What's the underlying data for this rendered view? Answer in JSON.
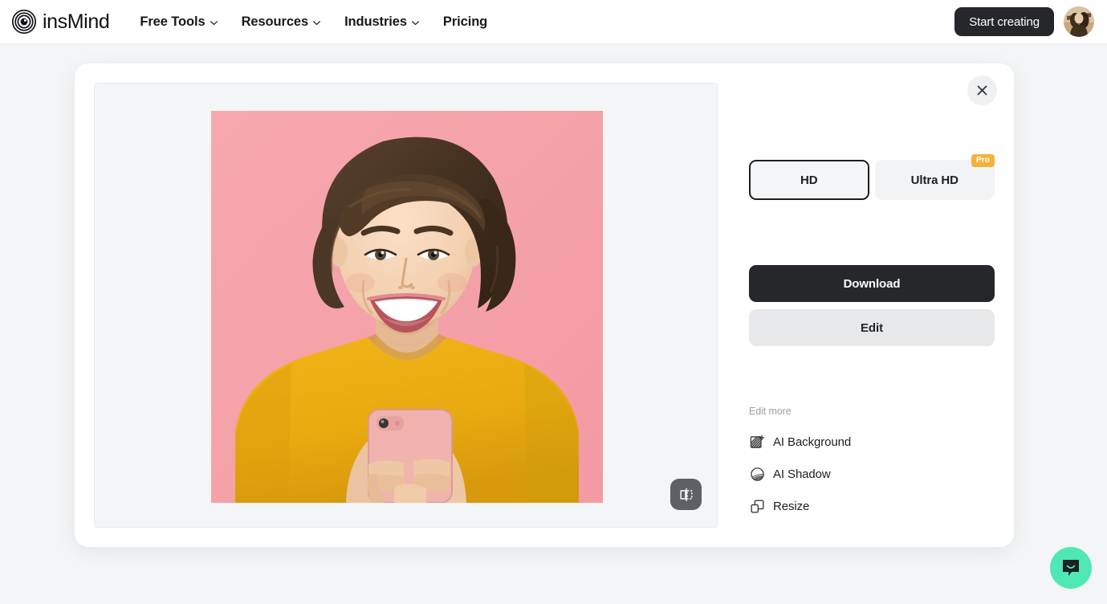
{
  "nav": {
    "brand": "insMind",
    "brand_logo_icon": "concentric-circles-logo",
    "links": [
      {
        "label": "Free Tools",
        "has_dropdown": true
      },
      {
        "label": "Resources",
        "has_dropdown": true
      },
      {
        "label": "Industries",
        "has_dropdown": true
      },
      {
        "label": "Pricing",
        "has_dropdown": false
      }
    ],
    "cta_label": "Start creating",
    "avatar_icon": "user-avatar"
  },
  "modal": {
    "close_icon": "close-icon",
    "canvas": {
      "compare_icon": "compare-split-view-icon",
      "image_description": "smiling-woman-holding-pink-phone-on-pink-background"
    },
    "panel": {
      "quality_options": [
        {
          "label": "HD",
          "selected": true,
          "badge": ""
        },
        {
          "label": "Ultra HD",
          "selected": false,
          "badge": "Pro"
        }
      ],
      "download_label": "Download",
      "edit_label": "Edit",
      "edit_more_label": "Edit more",
      "edit_more_items": [
        {
          "label": "AI Background",
          "icon": "ai-background-icon"
        },
        {
          "label": "AI Shadow",
          "icon": "ai-shadow-icon"
        },
        {
          "label": "Resize",
          "icon": "resize-icon"
        }
      ]
    }
  },
  "chat": {
    "icon": "chat-bubble-smile-icon"
  },
  "colors": {
    "page_background": "#f4f5f7",
    "accent_dark": "#26272b",
    "pro_badge": "#f2b33d",
    "chat_green": "#4fe8b5",
    "canvas_background": "#f4f5f7"
  }
}
